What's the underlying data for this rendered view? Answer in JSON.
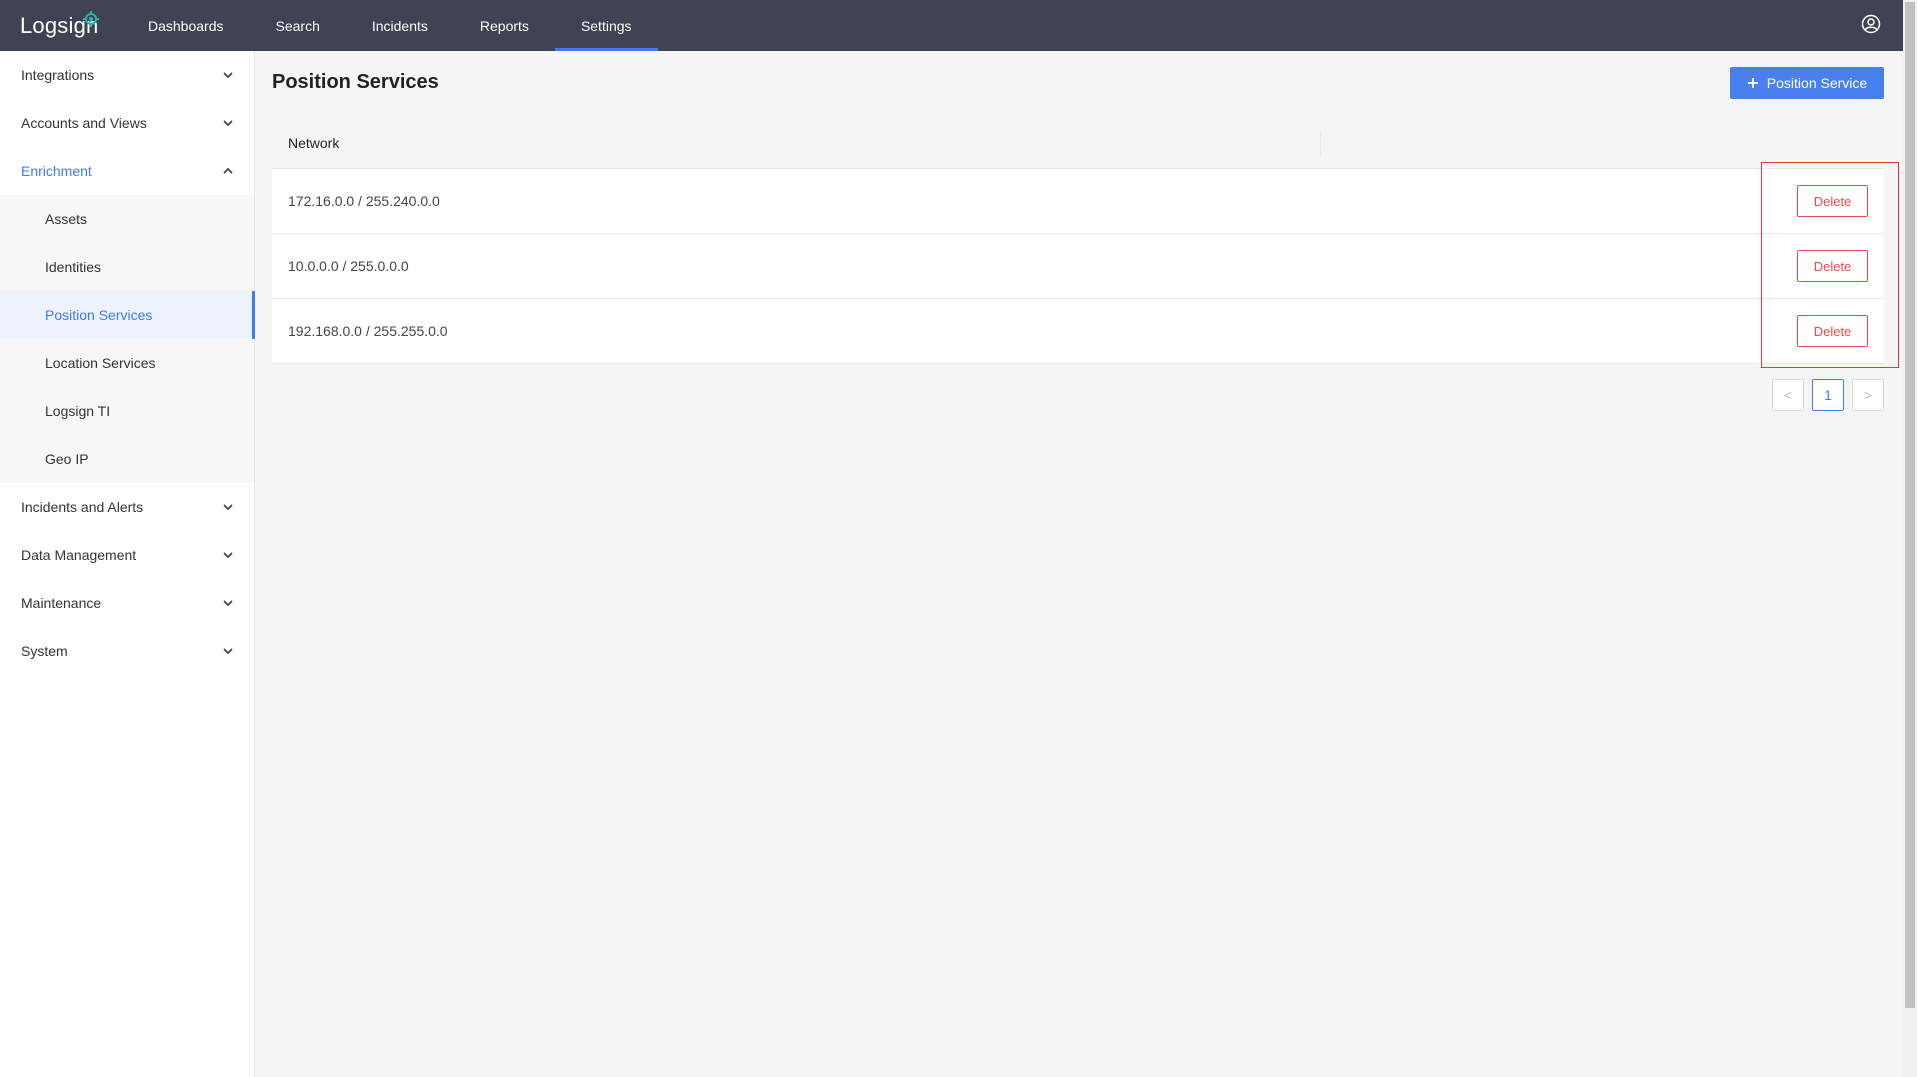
{
  "app": {
    "logo_text": "Logsign"
  },
  "nav": {
    "items": [
      {
        "label": "Dashboards"
      },
      {
        "label": "Search"
      },
      {
        "label": "Incidents"
      },
      {
        "label": "Reports"
      },
      {
        "label": "Settings"
      }
    ],
    "active": "Settings"
  },
  "sidebar": {
    "items": [
      {
        "label": "Integrations"
      },
      {
        "label": "Accounts and Views"
      },
      {
        "label": "Enrichment"
      },
      {
        "label": "Incidents and Alerts"
      },
      {
        "label": "Data Management"
      },
      {
        "label": "Maintenance"
      },
      {
        "label": "System"
      }
    ],
    "enrichment_sub": [
      {
        "label": "Assets"
      },
      {
        "label": "Identities"
      },
      {
        "label": "Position Services"
      },
      {
        "label": "Location Services"
      },
      {
        "label": "Logsign TI"
      },
      {
        "label": "Geo IP"
      }
    ],
    "active_sub": "Position Services"
  },
  "page": {
    "title": "Position Services",
    "add_button": "Position Service"
  },
  "table": {
    "header": "Network",
    "rows": [
      {
        "network": "172.16.0.0 / 255.240.0.0",
        "action": "Delete"
      },
      {
        "network": "10.0.0.0 / 255.0.0.0",
        "action": "Delete"
      },
      {
        "network": "192.168.0.0 / 255.255.0.0",
        "action": "Delete"
      }
    ]
  },
  "pagination": {
    "current_page": "1",
    "prev": "<",
    "next": ">"
  },
  "colors": {
    "topbar": "#3e4253",
    "accent": "#3f7cf0",
    "danger": "#e74c4c"
  }
}
